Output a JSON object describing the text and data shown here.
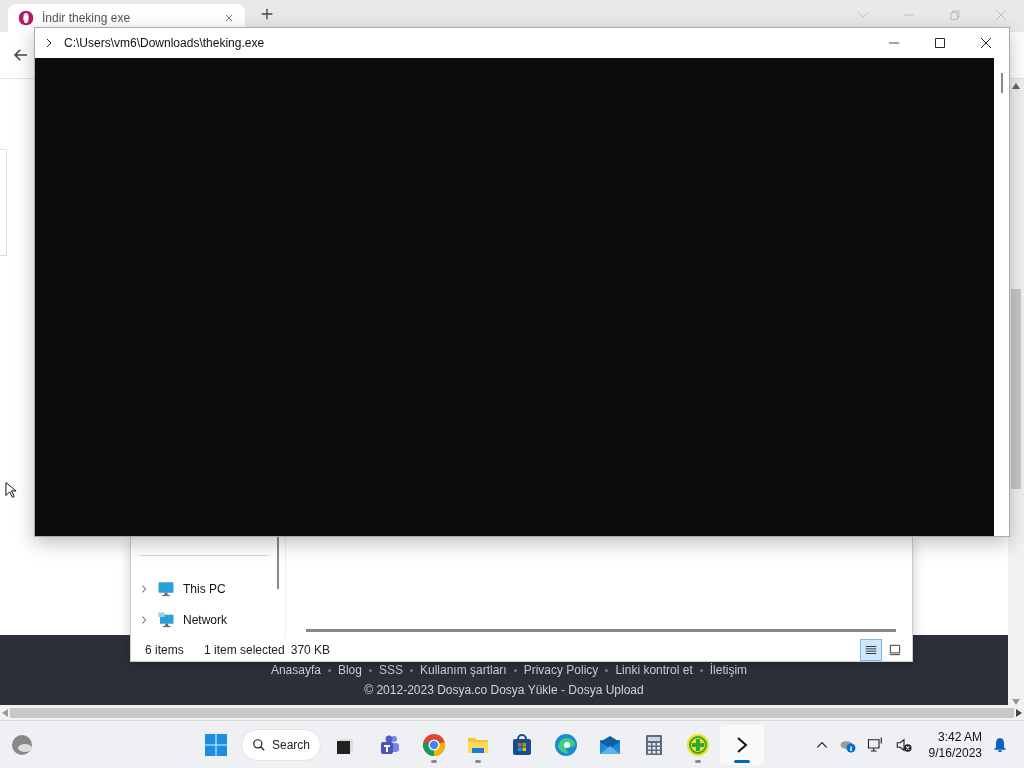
{
  "browser": {
    "tab": {
      "title": "İndir theking exe"
    },
    "footer": {
      "links": [
        "Anasayfa",
        "Blog",
        "SSS",
        "Kullanım şartları",
        "Privacy Policy",
        "Linki kontrol et",
        "İletişim"
      ],
      "copyright": "© 2012-2023 Dosya.co Dosya Yükle - Dosya Upload"
    }
  },
  "explorer": {
    "nav_items": [
      {
        "label": "This PC",
        "kind": "pc",
        "expanded": false
      },
      {
        "label": "Network",
        "kind": "network",
        "expanded": false
      }
    ],
    "status": {
      "count": "6 items",
      "selection": "1 item selected",
      "size": "370 KB"
    },
    "views": [
      {
        "kind": "details",
        "selected": true
      },
      {
        "kind": "tiles",
        "selected": false
      }
    ]
  },
  "terminal": {
    "title": "C:\\Users\\vm6\\Downloads\\theking.exe"
  },
  "taskbar": {
    "search": "Search",
    "apps": [
      {
        "kind": "taskview",
        "running": false,
        "active": false
      },
      {
        "kind": "teams",
        "running": false,
        "active": false
      },
      {
        "kind": "chrome",
        "running": true,
        "active": false
      },
      {
        "kind": "files",
        "running": true,
        "active": false
      },
      {
        "kind": "store",
        "running": false,
        "active": false
      },
      {
        "kind": "edge",
        "running": false,
        "active": false
      },
      {
        "kind": "mail",
        "running": false,
        "active": false
      },
      {
        "kind": "calculator",
        "running": false,
        "active": false
      },
      {
        "kind": "security",
        "running": true,
        "active": false
      },
      {
        "kind": "terminal",
        "running": true,
        "active": true
      }
    ],
    "time": "3:42 AM",
    "date": "9/16/2023"
  }
}
